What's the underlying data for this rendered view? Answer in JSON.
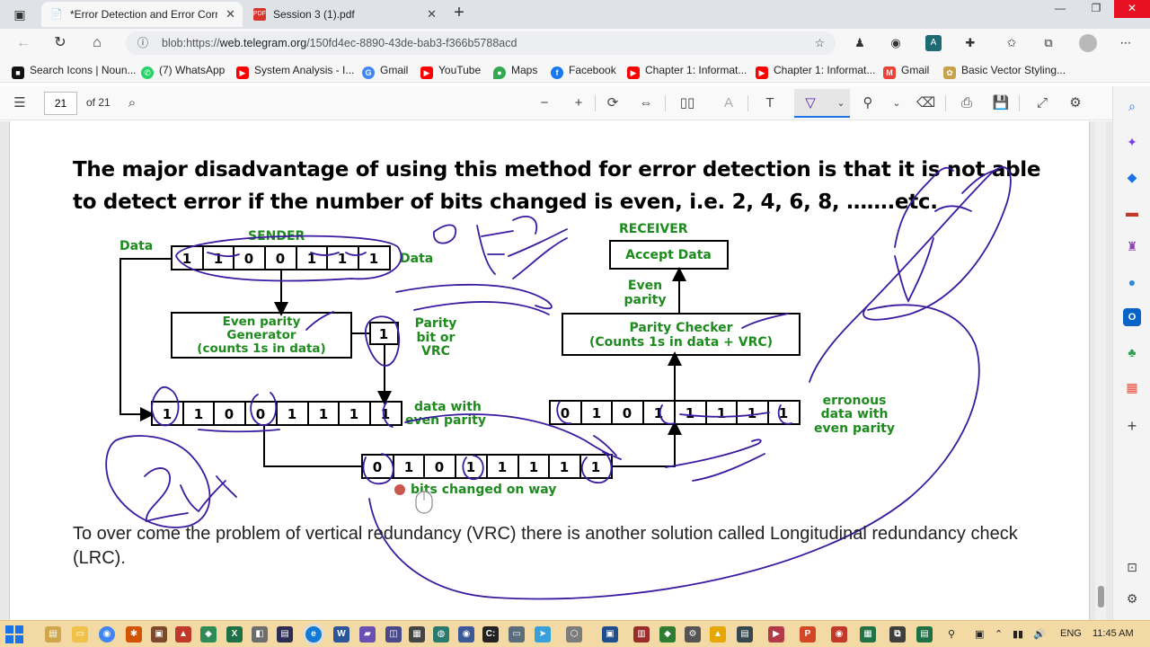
{
  "browser": {
    "tabs": [
      {
        "title": "*Error Detection and Error Correc",
        "active": true
      },
      {
        "title": "Session 3 (1).pdf",
        "active": false
      }
    ],
    "url_prefix": "blob:https://",
    "url_host": "web.telegram.org",
    "url_path": "/150fd4ec-8890-43de-bab3-f366b5788acd"
  },
  "bookmarks": [
    {
      "label": "Search Icons | Noun...",
      "color": "#111111",
      "glyph": "■"
    },
    {
      "label": "(7) WhatsApp",
      "color": "#25d366",
      "glyph": "✆"
    },
    {
      "label": "System Analysis - I...",
      "color": "#ff0000",
      "glyph": "▶"
    },
    {
      "label": "Gmail",
      "color": "#4285f4",
      "glyph": "G"
    },
    {
      "label": "YouTube",
      "color": "#ff0000",
      "glyph": "▶"
    },
    {
      "label": "Maps",
      "color": "#34a853",
      "glyph": "●"
    },
    {
      "label": "Facebook",
      "color": "#1877f2",
      "glyph": "f"
    },
    {
      "label": "Chapter 1: Informat...",
      "color": "#ff0000",
      "glyph": "▶"
    },
    {
      "label": "Chapter 1: Informat...",
      "color": "#ff0000",
      "glyph": "▶"
    },
    {
      "label": "Gmail",
      "color": "#ea4335",
      "glyph": "M"
    },
    {
      "label": "Basic Vector Styling...",
      "color": "#c8a24a",
      "glyph": "✿"
    }
  ],
  "pdf_toolbar": {
    "page_number": "21",
    "page_total": "of 21"
  },
  "document": {
    "heading": "The major disadvantage of using this method for error detection is that it is not able to detect error if the number of bits changed is even, i.e. 2, 4, 6, 8, …….etc.",
    "body": "To over come the problem of vertical redundancy (VRC) there is another solution called Longitudinal redundancy check (LRC).",
    "diagram": {
      "sender_label": "SENDER",
      "receiver_label": "RECEIVER",
      "data_left_label": "Data",
      "data_right_label": "Data",
      "sender_bits": [
        "1",
        "1",
        "0",
        "0",
        "1",
        "1",
        "1"
      ],
      "generator_line1": "Even parity",
      "generator_line2": "Generator",
      "generator_line3": "(counts 1s in data)",
      "parity_bit": "1",
      "parity_label1": "Parity",
      "parity_label2": "bit or",
      "parity_label3": "VRC",
      "sent_bits": [
        "1",
        "1",
        "0",
        "0",
        "1",
        "1",
        "1",
        "1"
      ],
      "sent_label1": "data with",
      "sent_label2": "even parity",
      "changed_bits": [
        "0",
        "1",
        "0",
        "1",
        "1",
        "1",
        "1",
        "1"
      ],
      "changed_label": "bits changed on way",
      "received_bits": [
        "0",
        "1",
        "0",
        "1",
        "1",
        "1",
        "1",
        "1"
      ],
      "erroneous_label1": "erronous",
      "erroneous_label2": "data with",
      "erroneous_label3": "even parity",
      "checker_line1": "Parity Checker",
      "checker_line2": "(Counts 1s in data + VRC)",
      "even_parity_line1": "Even",
      "even_parity_line2": "parity",
      "accept_label": "Accept Data"
    }
  },
  "taskbar": {
    "language": "ENG",
    "time": "11:45 AM"
  },
  "colors": {
    "diagram_green": "#1d8b1d",
    "ink_annotation": "#3a1aa0",
    "taskbar": "#f3d9a4"
  }
}
